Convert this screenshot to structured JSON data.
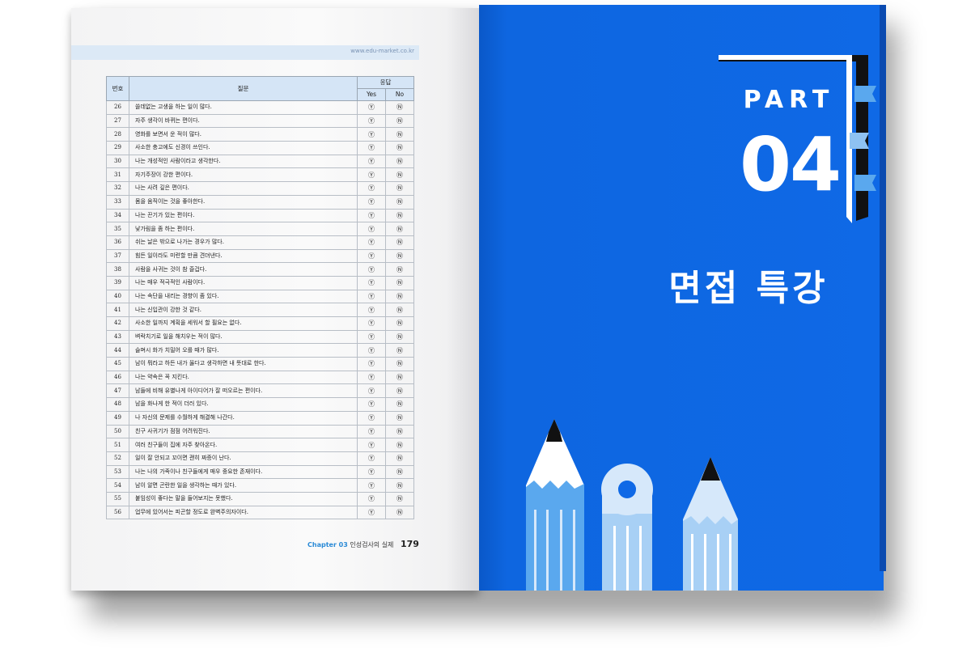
{
  "left_page": {
    "url": "www.edu-market.co.kr",
    "table": {
      "header_no": "번호",
      "header_question": "질문",
      "header_answer": "응답",
      "header_yes": "Yes",
      "header_no_ans": "No",
      "yes_symbol": "Ⓨ",
      "no_symbol": "Ⓝ",
      "rows": [
        {
          "no": "26",
          "q": "쓸데없는 고생을 하는 일이 많다."
        },
        {
          "no": "27",
          "q": "자주 생각이 바뀌는 편이다."
        },
        {
          "no": "28",
          "q": "영화를 보면서 운 적이 많다."
        },
        {
          "no": "29",
          "q": "사소한 충고에도 신경이 쓰인다."
        },
        {
          "no": "30",
          "q": "나는 개성적인 사람이라고 생각한다."
        },
        {
          "no": "31",
          "q": "자기주장이 강한 편이다."
        },
        {
          "no": "32",
          "q": "나는 사려 깊은 편이다."
        },
        {
          "no": "33",
          "q": "몸을 움직이는 것을 좋아한다."
        },
        {
          "no": "34",
          "q": "나는 끈기가 있는 편이다."
        },
        {
          "no": "35",
          "q": "낯가림을 좀 하는 편이다."
        },
        {
          "no": "36",
          "q": "쉬는 날은 밖으로 나가는 경우가 많다."
        },
        {
          "no": "37",
          "q": "힘든 일이라도 미련할 만큼 견뎌낸다."
        },
        {
          "no": "38",
          "q": "사람을 사귀는 것이 참 즐겁다."
        },
        {
          "no": "39",
          "q": "나는 매우 적극적인 사람이다."
        },
        {
          "no": "40",
          "q": "나는 속단을 내리는 경향이 좀 있다."
        },
        {
          "no": "41",
          "q": "나는 신입관이 강한 것 같다."
        },
        {
          "no": "42",
          "q": "사소한 일까지 계획을 세워서 할 필요는 없다."
        },
        {
          "no": "43",
          "q": "벼락치기로 일을 해치우는 적이 많다."
        },
        {
          "no": "44",
          "q": "슬며시 화가 치밀어 오를 때가 많다."
        },
        {
          "no": "45",
          "q": "남이 뭐라고 하든 내가 옳다고 생각하면 내 뜻대로 한다."
        },
        {
          "no": "46",
          "q": "나는 약속은 꼭 지킨다."
        },
        {
          "no": "47",
          "q": "남들에 비해 유별나게 아이디어가 잘 떠오르는 편이다."
        },
        {
          "no": "48",
          "q": "남을 화나게 한 적이 더러 있다."
        },
        {
          "no": "49",
          "q": "나 자신의 문제를 수월하게 해결해 나간다."
        },
        {
          "no": "50",
          "q": "친구 사귀기가 점점 어려워진다."
        },
        {
          "no": "51",
          "q": "여러 친구들이 집에 자주 찾아온다."
        },
        {
          "no": "52",
          "q": "일이 잘 안되고 꼬이면 괜히 짜증이 난다."
        },
        {
          "no": "53",
          "q": "나는 나의 가족이나 친구들에게 매우 중요한 존재이다."
        },
        {
          "no": "54",
          "q": "남이 알면 곤란한 일을 생각하는 때가 있다."
        },
        {
          "no": "55",
          "q": "붙임성이 좋다는 말을 들어보지는 못했다."
        },
        {
          "no": "56",
          "q": "업무에 있어서는 피곤할 정도로 완벽주의자이다."
        }
      ]
    },
    "footer": {
      "chapter": "Chapter 03",
      "chapter_title": "인성검사의 실제",
      "page_number": "179"
    }
  },
  "right_page": {
    "part_label": "PART",
    "part_number": "04",
    "title": "면접 특강"
  },
  "colors": {
    "accent_blue": "#0f69e6",
    "light_blue": "#5aa8ee",
    "pale_blue": "#d6e8fa"
  }
}
